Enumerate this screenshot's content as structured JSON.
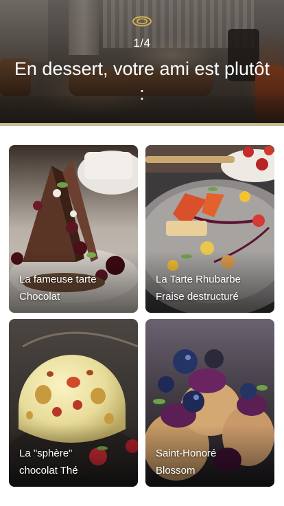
{
  "header": {
    "progress": "1/4",
    "question": "En dessert, votre ami est plutôt :"
  },
  "options": [
    {
      "label_line1": "La fameuse tarte",
      "label_line2": "Chocolat"
    },
    {
      "label_line1": "La Tarte Rhubarbe",
      "label_line2": "Fraise destructuré"
    },
    {
      "label_line1": "La \"sphère\"",
      "label_line2": "chocolat Thé"
    },
    {
      "label_line1": "Saint-Honoré",
      "label_line2": "Blossom"
    }
  ],
  "colors": {
    "accent_gold": "#c8b98e",
    "text_light": "#ffffff"
  },
  "icons": {
    "brand": "gold-ring-logo-icon"
  }
}
